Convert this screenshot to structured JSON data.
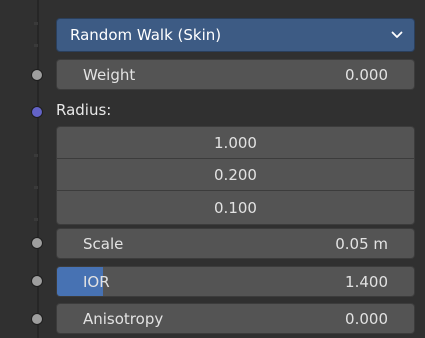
{
  "dropdown": {
    "value": "Random Walk (Skin)"
  },
  "weight": {
    "label": "Weight",
    "value": "0.000"
  },
  "radius": {
    "label": "Radius:",
    "values": [
      "1.000",
      "0.200",
      "0.100"
    ]
  },
  "scale": {
    "label": "Scale",
    "value": "0.05 m"
  },
  "ior": {
    "label": "IOR",
    "value": "1.400",
    "fill_fraction": 0.13
  },
  "anisotropy": {
    "label": "Anisotropy",
    "value": "0.000"
  },
  "colors": {
    "panel_bg": "#303030",
    "field_bg": "#545454",
    "dropdown_bg": "#3d5b84",
    "accent": "#4772b3",
    "socket_float": "#9e9e9e",
    "socket_vector": "#6363c7"
  },
  "icons": {
    "dropdown_chevron": "chevron-down-icon"
  }
}
